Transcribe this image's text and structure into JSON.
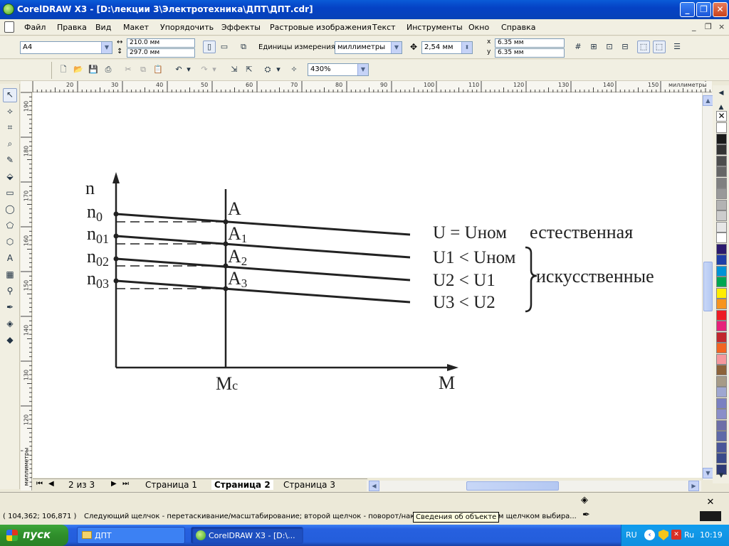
{
  "window": {
    "title": "CorelDRAW X3 - [D:\\лекции 3\\Электротехника\\ДПТ\\ДПТ.cdr]",
    "minimize_glyph": "_",
    "restore_glyph": "❐",
    "close_glyph": "✕"
  },
  "menu": {
    "items": [
      "Файл",
      "Правка",
      "Вид",
      "Макет",
      "Упорядочить",
      "Эффекты",
      "Растровые изображения",
      "Текст",
      "Инструменты",
      "Окно",
      "Справка"
    ],
    "mdi_min": "_",
    "mdi_restore": "❐",
    "mdi_close": "×"
  },
  "property_bar": {
    "paper_size": "A4",
    "width": "210.0 мм",
    "height": "297.0 мм",
    "units_label": "Единицы измерения:",
    "units_value": "миллиметры",
    "nudge": "2,54 мм",
    "dup_x": "6.35 мм",
    "dup_y": "6.35 мм",
    "x_label": "x",
    "y_label": "y"
  },
  "standard_bar": {
    "zoom": "430%"
  },
  "rulers": {
    "horizontal_ticks": [
      "20",
      "30",
      "40",
      "50",
      "60",
      "70",
      "80",
      "90",
      "100",
      "110",
      "120",
      "130",
      "140",
      "150"
    ],
    "horizontal_units": "миллиметры",
    "vertical_ticks": [
      "190",
      "180",
      "170",
      "160",
      "150",
      "140",
      "130",
      "120"
    ],
    "vertical_units": "миллиметры"
  },
  "diagram": {
    "y_axis_label": "n",
    "x_axis_label": "M",
    "mc_label": "M",
    "mc_sub": "c",
    "n_labels": [
      {
        "main": "n",
        "sub": "0"
      },
      {
        "main": "n",
        "sub": "01"
      },
      {
        "main": "n",
        "sub": "02"
      },
      {
        "main": "n",
        "sub": "03"
      }
    ],
    "point_labels": [
      {
        "main": "A",
        "sub": ""
      },
      {
        "main": "A",
        "sub": "1"
      },
      {
        "main": "A",
        "sub": "2"
      },
      {
        "main": "A",
        "sub": "3"
      }
    ],
    "curve_labels": [
      "U = Uном",
      "U1 < Uном",
      "U2 < U1",
      "U3 < U2"
    ],
    "natural_label": "естественная",
    "artificial_label": "искусственные"
  },
  "page_tabs": {
    "counter": "2 из 3",
    "tabs": [
      "Страница 1",
      "Страница 2",
      "Страница 3"
    ],
    "active_index": 1
  },
  "palette": {
    "colors": [
      "#ffffff",
      "#1a1a1a",
      "#333333",
      "#4d4d4d",
      "#666666",
      "#808080",
      "#999999",
      "#b3b3b3",
      "#cccccc",
      "#e6e6e6",
      "#ffffff",
      "#2b1a6e",
      "#1f3fa8",
      "#0093d6",
      "#00a651",
      "#ffed00",
      "#f7941d",
      "#ed1c24",
      "#e6217a",
      "#c1272d",
      "#f26522",
      "#f5989d",
      "#8c6239",
      "#a69b87",
      "#9fa7d1",
      "#7a80c1",
      "#8a8ec9",
      "#6d6fa8",
      "#5f6aa8",
      "#4a5699",
      "#3a4a8a",
      "#2e3a75"
    ]
  },
  "status": {
    "coords": "( 104,362; 106,871 )",
    "message": "Следующий щелчок - перетаскивание/масштабирование; второй щелчок - поворот/накло",
    "message_tail": "ым щелчком выбира...",
    "tooltip": "Сведения об объекте"
  },
  "taskbar": {
    "start": "пуск",
    "tasks": [
      "ДПТ",
      "CorelDRAW X3 - [D:\\..."
    ],
    "lang": "RU",
    "tray_lang": "Ru",
    "time": "10:19"
  }
}
